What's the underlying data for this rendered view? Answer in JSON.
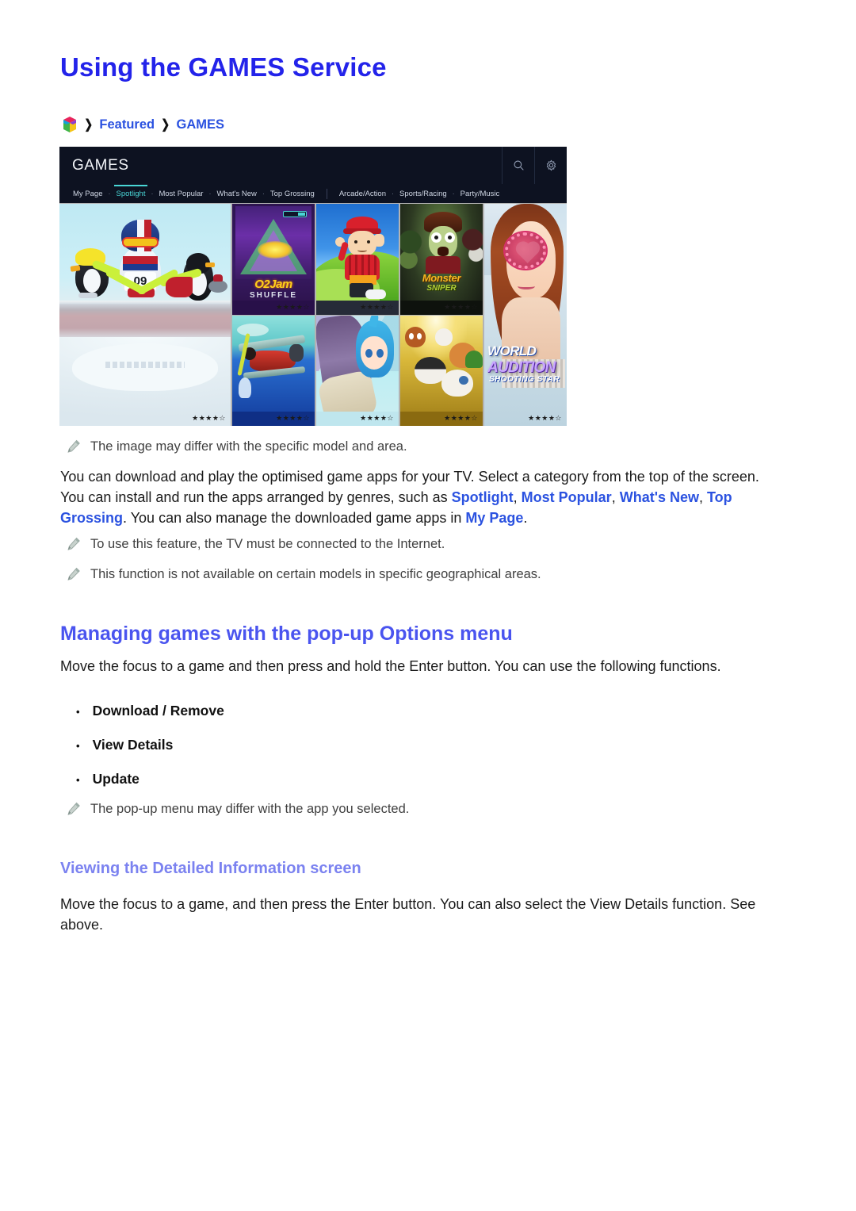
{
  "page": {
    "title": "Using the GAMES Service"
  },
  "breadcrumb": {
    "icon": "smart-hub-cube-icon",
    "sep": "❯",
    "items": [
      {
        "label": "Featured"
      },
      {
        "label": "GAMES"
      }
    ]
  },
  "tv_screenshot": {
    "header": {
      "title": "GAMES",
      "icons": [
        {
          "name": "search-icon"
        },
        {
          "name": "settings-gear-icon"
        }
      ]
    },
    "nav": {
      "items": [
        {
          "label": "My Page",
          "active": false
        },
        {
          "label": "Spotlight",
          "active": true
        },
        {
          "label": "Most Popular",
          "active": false
        },
        {
          "label": "What's New",
          "active": false
        },
        {
          "label": "Top Grossing",
          "active": false
        },
        {
          "label": "Arcade/Action",
          "active": false
        },
        {
          "label": "Sports/Racing",
          "active": false
        },
        {
          "label": "Party/Music",
          "active": false
        }
      ],
      "separator_dot": "·"
    },
    "tiles": [
      {
        "name": "penguin-curling-game",
        "rating": "★★★★☆"
      },
      {
        "name": "ojam-shuffle-game",
        "title": "O2Jam",
        "subtitle": "SHUFFLE",
        "rating": "★★★★☆"
      },
      {
        "name": "boy-outdoor-game",
        "rating": "★★★★☆"
      },
      {
        "name": "monster-sniper-game",
        "title": "Monster",
        "subtitle": "SNIPER",
        "rating": "★★★★☆"
      },
      {
        "name": "world-audition-shooting-star-game",
        "title": "WORLD",
        "title2": "AUDITION",
        "subtitle": "SHOOTING STAR",
        "rating": "★★★★☆"
      },
      {
        "name": "biplane-game",
        "rating": "★★★★☆"
      },
      {
        "name": "anime-girl-game",
        "rating": "★★★★☆"
      },
      {
        "name": "puppy-dogs-game",
        "rating": "★★★★☆"
      }
    ]
  },
  "notes": {
    "image_differ": "The image may differ with the specific model and area.",
    "internet_required": "To use this feature, the TV must be connected to the Internet.",
    "not_available": "This function is not available on certain models in specific geographical areas.",
    "popup_differ": "The pop-up menu may differ with the app you selected."
  },
  "intro": {
    "part1": "You can download and play the optimised game apps for your TV. Select a category from the top of the screen. You can install and run the apps arranged by genres, such as ",
    "link1": "Spotlight",
    "sep1": ", ",
    "link2": "Most Popular",
    "sep2": ", ",
    "link3": "What's New",
    "sep3": ", ",
    "link4": "Top Grossing",
    "part2": ". You can also manage the downloaded game apps in ",
    "link5": "My Page",
    "part3": "."
  },
  "managing": {
    "heading": "Managing games with the pop-up Options menu",
    "body": "Move the focus to a game and then press and hold the Enter button. You can use the following functions.",
    "bullet_marker": "•",
    "options": [
      {
        "label": "Download / Remove"
      },
      {
        "label": "View Details"
      },
      {
        "label": "Update"
      }
    ]
  },
  "viewing": {
    "heading": "Viewing the Detailed Information screen",
    "body": "Move the focus to a game, and then press the Enter button. You can also select the View Details function. See above."
  },
  "colors": {
    "title_blue": "#2323EA",
    "h2_blue": "#4A54EF",
    "h3_blue": "#7B82F0",
    "link_blue": "#2B52E0",
    "tv_header_bg": "#0D1221",
    "tv_accent": "#49D6D6"
  }
}
